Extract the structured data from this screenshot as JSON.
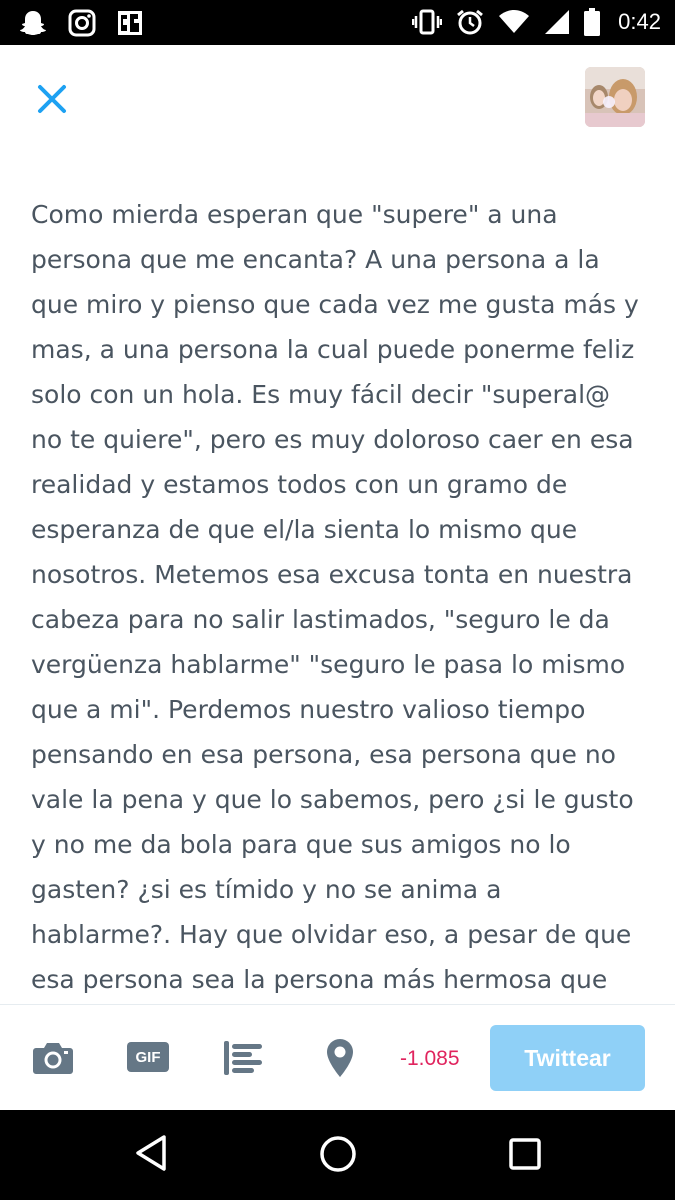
{
  "status_bar": {
    "time": "0:42",
    "left_icons": [
      "snapchat-icon",
      "instagram-icon",
      "pixel-app-icon"
    ],
    "right_icons": [
      "vibrate-icon",
      "alarm-icon",
      "wifi-icon",
      "signal-icon",
      "battery-icon"
    ]
  },
  "header": {
    "close_icon": "close-icon",
    "avatar": "profile-avatar"
  },
  "compose": {
    "text": "Como mierda esperan que \"supere\" a una\npersona que me encanta? A una persona a la\nque miro y pienso que cada vez me gusta más y\nmas, a una persona la cual puede ponerme feliz\nsolo con un hola. Es muy fácil decir \"superal@\nno te quiere\", pero es muy doloroso caer en esa\nrealidad y estamos todos con un gramo de\nesperanza de que el/la sienta lo mismo que\nnosotros. Metemos esa excusa tonta en nuestra\ncabeza para no salir lastimados, \"seguro le da\nvergüenza hablarme\" \"seguro le pasa lo mismo\nque a mi\". Perdemos nuestro valioso tiempo\npensando en esa persona, esa persona que no\nvale la pena y que lo sabemos, pero ¿si le gusto\ny no me da bola para que sus amigos no lo\ngasten? ¿si es tímido y no se anima a\nhablarme?. Hay que olvidar eso, a pesar de que\nesa persona sea la persona más hermosa que"
  },
  "toolbar": {
    "icons": [
      "camera-icon",
      "gif-icon",
      "poll-icon",
      "location-icon"
    ],
    "gif_label": "GIF",
    "counter": "-1.085",
    "tweet_label": "Twittear",
    "counter_color": "#e0245e",
    "button_color": "#8fd0f7"
  },
  "nav_bar": {
    "icons": [
      "back-icon",
      "home-icon",
      "recents-icon"
    ]
  }
}
